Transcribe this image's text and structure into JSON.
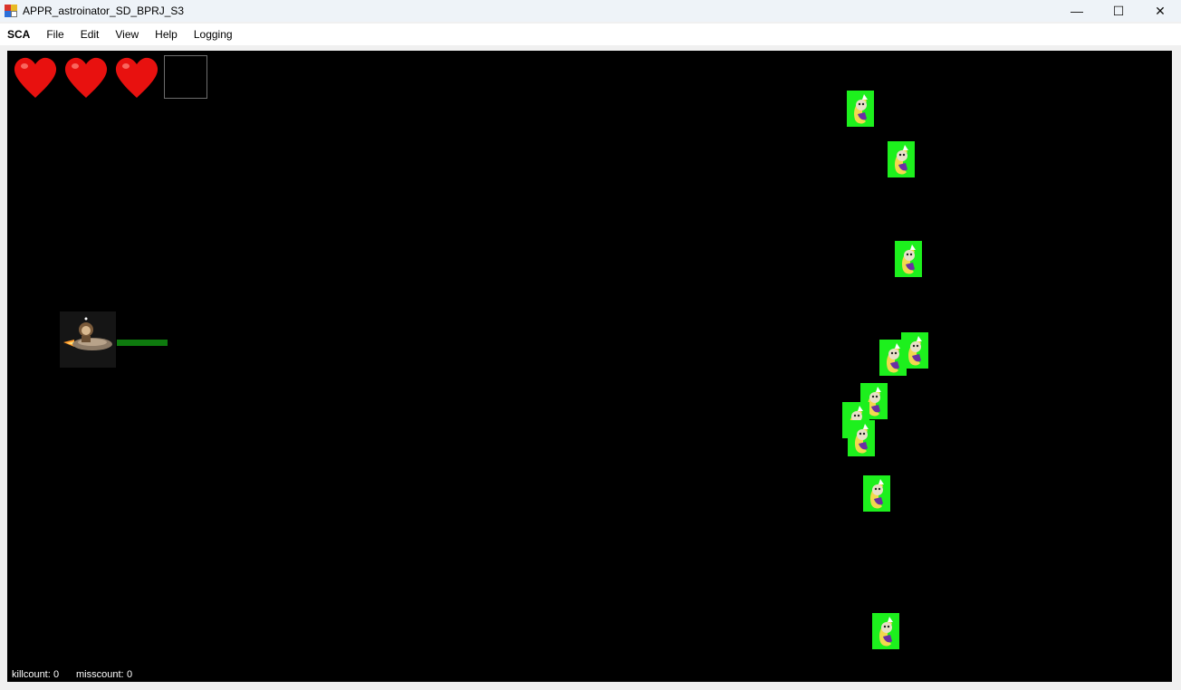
{
  "window": {
    "title": "APPR_astroinator_SD_BPRJ_S3",
    "controls": {
      "minimize": "—",
      "maximize": "☐",
      "close": "✕"
    }
  },
  "menu": {
    "items": [
      "SCA",
      "File",
      "Edit",
      "View",
      "Help",
      "Logging"
    ]
  },
  "game": {
    "lives": 3,
    "hearts_icon": "heart-icon",
    "player_icon": "spaceship-icon",
    "enemy_icon": "banana-enemy-icon",
    "enemy_count": 11,
    "colors": {
      "background": "#000000",
      "heart": "#e8110f",
      "laser": "#0e7a0e",
      "enemy_bg": "#1df01d"
    }
  },
  "status": {
    "killcount_label": "killcount:",
    "killcount_value": "0",
    "misscount_label": "misscount:",
    "misscount_value": "0"
  }
}
